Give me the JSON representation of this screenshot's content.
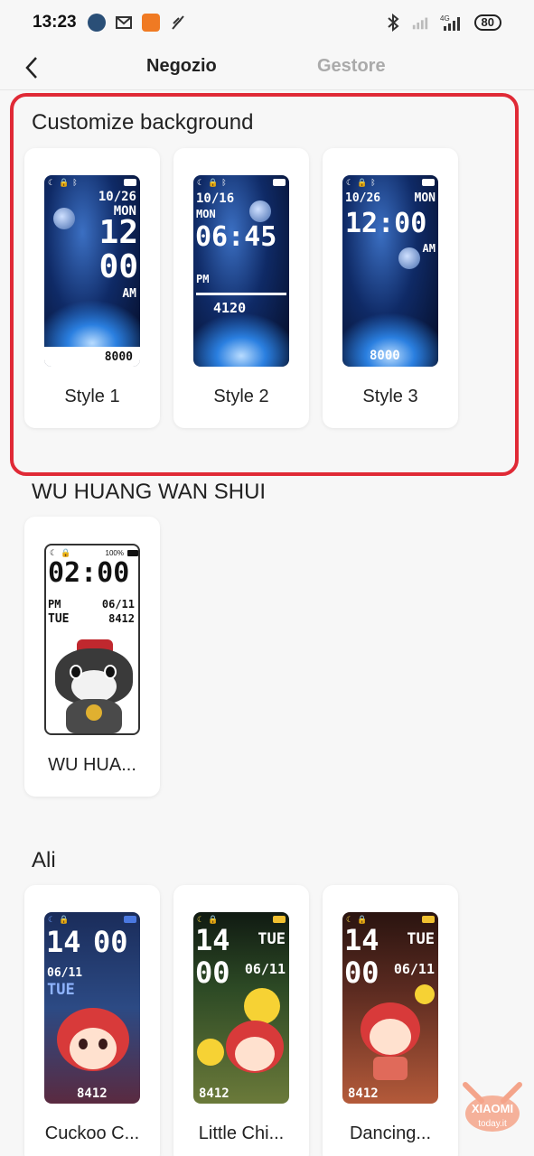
{
  "status_bar": {
    "time": "13:23",
    "battery": "80",
    "network": "4G"
  },
  "header": {
    "tab_shop": "Negozio",
    "tab_manager": "Gestore"
  },
  "sections": {
    "custom": {
      "title": "Customize background",
      "cards": [
        {
          "label": "Style 1",
          "date": "10/26",
          "day": "MON",
          "hour": "12",
          "minute": "00",
          "ampm": "AM",
          "steps": "8000"
        },
        {
          "label": "Style 2",
          "date": "10/16",
          "day": "MON",
          "time": "06:45",
          "ampm": "PM",
          "steps": "4120"
        },
        {
          "label": "Style 3",
          "date": "10/26",
          "day": "MON",
          "time": "12:00",
          "ampm": "AM",
          "steps": "8000"
        }
      ]
    },
    "wu": {
      "title": "WU HUANG WAN SHUI",
      "cards": [
        {
          "label": "WU HUA...",
          "battery": "100%",
          "time": "02:00",
          "ampm": "PM",
          "date": "06/11",
          "day": "TUE",
          "steps": "8412"
        }
      ]
    },
    "ali": {
      "title": "Ali",
      "cards": [
        {
          "label": "Cuckoo C...",
          "hour": "14",
          "minute": "00",
          "date": "06/11",
          "day": "TUE",
          "steps": "8412"
        },
        {
          "label": "Little Chi...",
          "hour": "14",
          "minute": "00",
          "date": "06/11",
          "day": "TUE",
          "steps": "8412"
        },
        {
          "label": "Dancing...",
          "hour": "14",
          "minute": "00",
          "date": "06/11",
          "day": "TUE",
          "steps": "8412"
        }
      ]
    }
  },
  "watermark": {
    "brand": "XIAOMI",
    "domain": "today.it"
  },
  "colors": {
    "highlight": "#e02a36",
    "tab_active": "#222222",
    "tab_inactive": "#aaaaaa"
  }
}
